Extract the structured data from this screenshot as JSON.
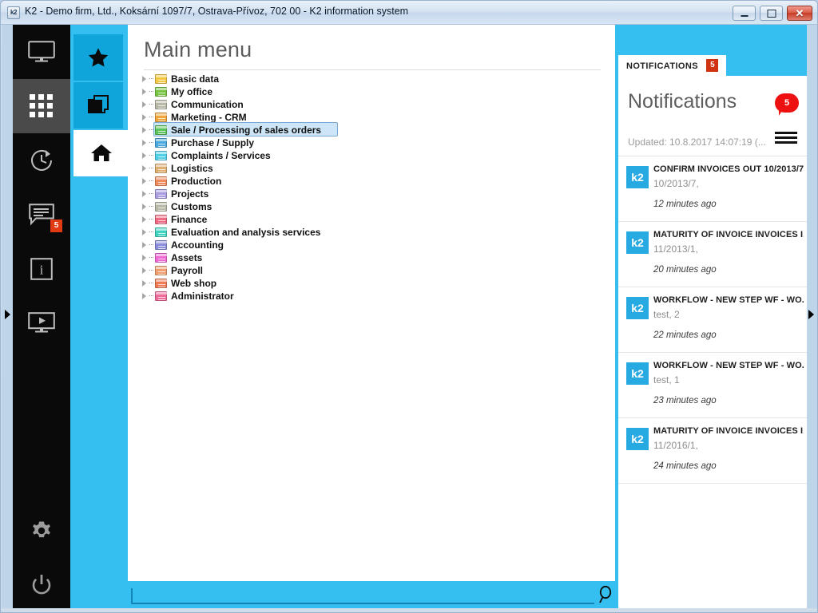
{
  "window": {
    "title": "K2 - Demo firm, Ltd., Koksární 1097/7, Ostrava-Přívoz, 702 00 - K2 information system",
    "app_icon": "k2",
    "minimize_label": "",
    "maximize_label": "",
    "close_label": "✕"
  },
  "rail": {
    "items": [
      {
        "name": "monitor-icon",
        "icon": "monitor",
        "badge": ""
      },
      {
        "name": "apps-grid-icon",
        "icon": "grid",
        "badge": "",
        "active": true
      },
      {
        "name": "history-clock-icon",
        "icon": "clock-arrow",
        "badge": ""
      },
      {
        "name": "messages-icon",
        "icon": "chat",
        "badge": "5"
      },
      {
        "name": "info-icon",
        "icon": "info",
        "badge": ""
      },
      {
        "name": "media-player-icon",
        "icon": "play-screen",
        "badge": ""
      }
    ],
    "bottom_items": [
      {
        "name": "settings-gear-icon",
        "icon": "gear"
      },
      {
        "name": "power-icon",
        "icon": "power"
      }
    ]
  },
  "tabcol": {
    "tabs": [
      {
        "name": "favorites-tab",
        "icon": "star",
        "active": false
      },
      {
        "name": "windows-tab",
        "icon": "copy",
        "active": false
      },
      {
        "name": "home-tab",
        "icon": "home",
        "active": true
      }
    ]
  },
  "main": {
    "title": "Main menu",
    "tree": [
      {
        "label": "Basic data",
        "color": "#f5c842",
        "expandable": true
      },
      {
        "label": "My office",
        "color": "#76c442",
        "expandable": true
      },
      {
        "label": "Communication",
        "color": "#b9b9a8",
        "expandable": true
      },
      {
        "label": "Marketing - CRM",
        "color": "#f0a63c",
        "expandable": true
      },
      {
        "label": "Sale / Processing of sales orders",
        "color": "#5cc45c",
        "expandable": true,
        "selected": true
      },
      {
        "label": "Purchase / Supply",
        "color": "#4aa8dd",
        "expandable": true
      },
      {
        "label": "Complaints / Services",
        "color": "#4fd0e8",
        "expandable": true
      },
      {
        "label": "Logistics",
        "color": "#e0b070",
        "expandable": true
      },
      {
        "label": "Production",
        "color": "#f08a5a",
        "expandable": true
      },
      {
        "label": "Projects",
        "color": "#a99ce0",
        "expandable": true
      },
      {
        "label": "Customs",
        "color": "#b9b9a8",
        "expandable": true
      },
      {
        "label": "Finance",
        "color": "#f06a82",
        "expandable": true
      },
      {
        "label": "Evaluation and analysis services",
        "color": "#3fd4c0",
        "expandable": true
      },
      {
        "label": "Accounting",
        "color": "#8a8ddb",
        "expandable": true
      },
      {
        "label": "Assets",
        "color": "#f06ad6",
        "expandable": true
      },
      {
        "label": "Payroll",
        "color": "#f0a070",
        "expandable": true
      },
      {
        "label": "Web shop",
        "color": "#f07a52",
        "expandable": true
      },
      {
        "label": "Administrator",
        "color": "#f06a9a",
        "expandable": true
      }
    ]
  },
  "search": {
    "value": "",
    "placeholder": "",
    "icon": "search-icon"
  },
  "notifications": {
    "tab_label": "NOTIFICATIONS",
    "tab_badge": "5",
    "title": "Notifications",
    "count_badge": "5",
    "updated": "Updated: 10.8.2017 14:07:19 (...",
    "menu_icon": "hamburger-icon",
    "items": [
      {
        "avatar": "k2",
        "title": "CONFIRM INVOICES OUT 10/2013/7,",
        "subtitle": "10/2013/7,",
        "time": "12 minutes ago"
      },
      {
        "avatar": "k2",
        "title": "MATURITY OF INVOICE INVOICES I...",
        "subtitle": "11/2013/1,",
        "time": "20 minutes ago"
      },
      {
        "avatar": "k2",
        "title": "WORKFLOW - NEW STEP WF - WO...",
        "subtitle": "test, 2",
        "time": "22 minutes ago"
      },
      {
        "avatar": "k2",
        "title": "WORKFLOW - NEW STEP WF - WO...",
        "subtitle": "test, 1",
        "time": "23 minutes ago"
      },
      {
        "avatar": "k2",
        "title": "MATURITY OF INVOICE INVOICES I...",
        "subtitle": "11/2016/1,",
        "time": "24 minutes ago"
      }
    ]
  },
  "edges": {
    "left_handle": "expand-left-panel-handle",
    "right_handle": "expand-right-panel-handle"
  },
  "colors": {
    "accent_blue": "#35bff0",
    "tab_blue": "#0fa5db",
    "badge_red": "#cf3311",
    "bubble_red": "#ee1111",
    "avatar_blue": "#27aae1",
    "rail_black": "#0a0a0a"
  }
}
